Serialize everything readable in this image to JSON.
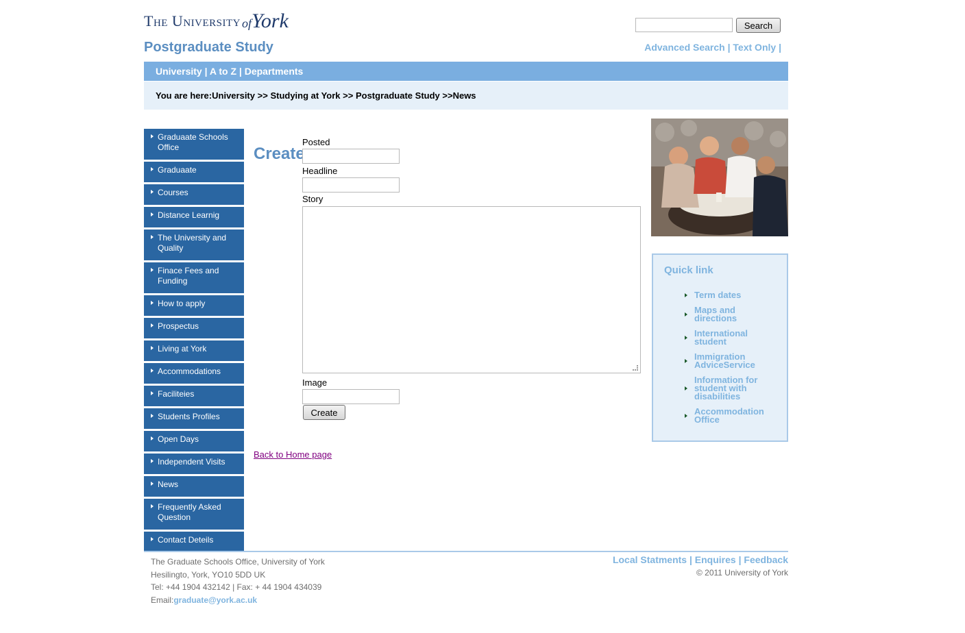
{
  "header": {
    "logo_caps": "The University",
    "logo_of": "of",
    "logo_york": "York",
    "site_title": "Postgraduate Study",
    "search_button": "Search",
    "advanced_search": "Advanced Search",
    "text_only": "Text Only",
    "link_separator": "|"
  },
  "navbar": {
    "items": [
      "University",
      "A to Z",
      "Departments"
    ],
    "separator": "|"
  },
  "breadcrumb": {
    "prefix": "You are here:",
    "items": [
      "University",
      "Studying at York",
      "Postgraduate Study",
      "News"
    ],
    "separator": ">>"
  },
  "sidebar": {
    "items": [
      {
        "label": "Graduaate Schools Office"
      },
      {
        "label": "Graduaate"
      },
      {
        "label": "Courses"
      },
      {
        "label": "Distance Learnig"
      },
      {
        "label": "The University and Quality"
      },
      {
        "label": "Finace Fees and Funding"
      },
      {
        "label": "How to apply"
      },
      {
        "label": "Prospectus"
      },
      {
        "label": "Living at York"
      },
      {
        "label": "Accommodations"
      },
      {
        "label": "Faciliteies"
      },
      {
        "label": "Students Profiles"
      },
      {
        "label": "Open Days"
      },
      {
        "label": "Independent Visits"
      },
      {
        "label": "News"
      },
      {
        "label": "Frequently Asked Question"
      },
      {
        "label": "Contact Deteils"
      }
    ]
  },
  "main": {
    "heading": "Create",
    "posted_label": "Posted",
    "posted_value": "",
    "headline_label": "Headline",
    "headline_value": "",
    "story_label": "Story",
    "story_value": "",
    "image_label": "Image",
    "image_value": "",
    "create_button": "Create",
    "back_link": "Back to Home page"
  },
  "quicklinks": {
    "title": "Quick link",
    "items": [
      {
        "label": "Term dates"
      },
      {
        "label": "Maps and directions"
      },
      {
        "label": "International student"
      },
      {
        "label": "Immigration AdviceService"
      },
      {
        "label": "Information for student with disabilities"
      },
      {
        "label": "Accommodation Office"
      }
    ]
  },
  "footer": {
    "address_line1": "The Graduate Schools Office, University of York",
    "address_line2": "Hesilingto, York, YO10 5DD UK",
    "phone_line": "Tel: +44 1904 432142 | Fax: + 44 1904 434039",
    "email_label": "Email:",
    "email": "graduate@york.ac.uk",
    "links": [
      "Local Statments",
      "Enquires",
      "Feedback"
    ],
    "link_separator": "|",
    "copyright": "© 2011 University of York"
  },
  "colors": {
    "nav_blue": "#7aaee0",
    "sidebar_blue": "#2a66a2",
    "title_blue": "#5b8ec1",
    "link_light_blue": "#7fb4df",
    "panel_bg": "#e6f0f9"
  }
}
